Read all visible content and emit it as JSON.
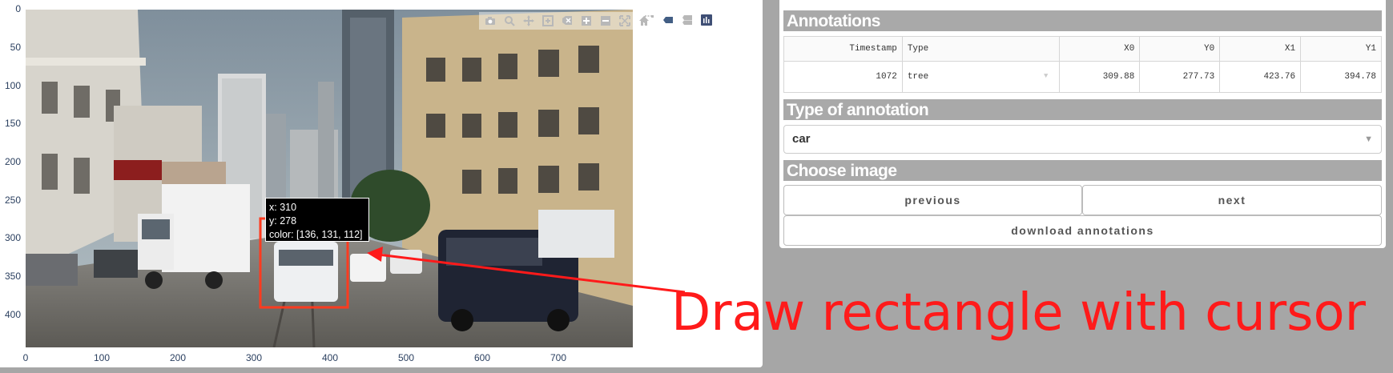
{
  "plot": {
    "y_ticks": [
      "0",
      "50",
      "100",
      "150",
      "200",
      "250",
      "300",
      "350",
      "400"
    ],
    "x_ticks": [
      "0",
      "100",
      "200",
      "300",
      "400",
      "500",
      "600",
      "700"
    ],
    "modebar_icons": [
      "camera-icon",
      "zoom-icon",
      "pan-icon",
      "select-box-icon",
      "lasso-icon",
      "zoom-in-icon",
      "zoom-out-icon",
      "autoscale-icon",
      "reset-axes-icon",
      "spike-lines-icon",
      "hover-closest-icon",
      "hover-compare-icon",
      "plotly-logo-icon"
    ],
    "hover": {
      "x_line": "x: 310",
      "y_line": "y: 278",
      "color_line": "color: [136, 131, 112]"
    },
    "rectangle_color": "#ff3b1f"
  },
  "annotations": {
    "title": "Annotations",
    "columns": [
      "Timestamp",
      "Type",
      "X0",
      "Y0",
      "X1",
      "Y1"
    ],
    "rows": [
      {
        "timestamp": "1072",
        "type": "tree",
        "x0": "309.88",
        "y0": "277.73",
        "x1": "423.76",
        "y1": "394.78"
      }
    ]
  },
  "type_of_annotation": {
    "title": "Type of annotation",
    "selected": "car"
  },
  "choose_image": {
    "title": "Choose image",
    "previous_label": "previous",
    "next_label": "next",
    "download_label": "download annotations"
  },
  "overlay": {
    "caption": "Draw rectangle with cursor",
    "color": "#ff1a1a"
  }
}
